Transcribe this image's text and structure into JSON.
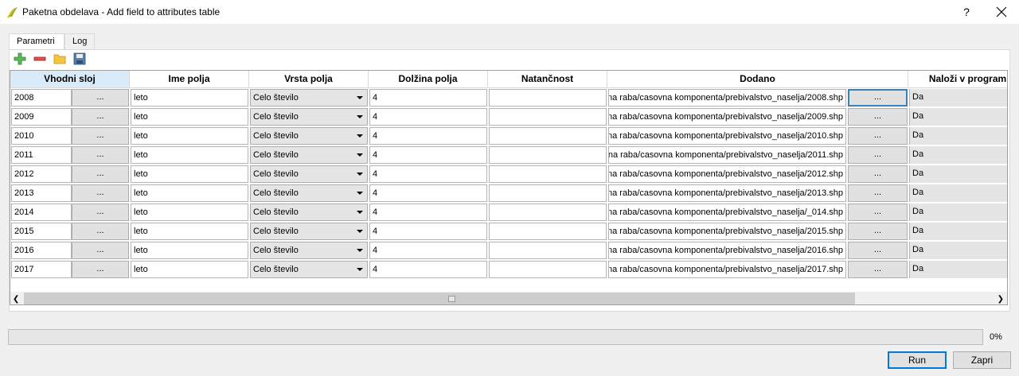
{
  "window": {
    "title": "Paketna obdelava - Add field to attributes table",
    "help_label": "?",
    "app_icon": "qgis-icon",
    "close_icon": "close-icon"
  },
  "tabs": [
    {
      "label": "Parametri",
      "active": true
    },
    {
      "label": "Log",
      "active": false
    }
  ],
  "toolbar": {
    "add_row": "add-row-icon",
    "remove_row": "remove-row-icon",
    "open": "folder-open-icon",
    "save": "save-icon"
  },
  "table": {
    "columns": [
      "Vhodni sloj",
      "Ime polja",
      "Vrsta polja",
      "Dolžina polja",
      "Natančnost",
      "Dodano",
      "Naloži v program"
    ],
    "browse_label": "...",
    "rows": [
      {
        "layer": "2008",
        "field_name": "leto",
        "field_type": "Celo število",
        "length": "4",
        "precision": "",
        "output": "na raba/casovna komponenta/prebivalstvo_naselja/2008.shp",
        "load": "Da"
      },
      {
        "layer": "2009",
        "field_name": "leto",
        "field_type": "Celo število",
        "length": "4",
        "precision": "",
        "output": "na raba/casovna komponenta/prebivalstvo_naselja/2009.shp",
        "load": "Da"
      },
      {
        "layer": "2010",
        "field_name": "leto",
        "field_type": "Celo število",
        "length": "4",
        "precision": "",
        "output": "na raba/casovna komponenta/prebivalstvo_naselja/2010.shp",
        "load": "Da"
      },
      {
        "layer": "2011",
        "field_name": "leto",
        "field_type": "Celo število",
        "length": "4",
        "precision": "",
        "output": "na raba/casovna komponenta/prebivalstvo_naselja/2011.shp",
        "load": "Da"
      },
      {
        "layer": "2012",
        "field_name": "leto",
        "field_type": "Celo število",
        "length": "4",
        "precision": "",
        "output": "na raba/casovna komponenta/prebivalstvo_naselja/2012.shp",
        "load": "Da"
      },
      {
        "layer": "2013",
        "field_name": "leto",
        "field_type": "Celo število",
        "length": "4",
        "precision": "",
        "output": "na raba/casovna komponenta/prebivalstvo_naselja/2013.shp",
        "load": "Da"
      },
      {
        "layer": "2014",
        "field_name": "leto",
        "field_type": "Celo število",
        "length": "4",
        "precision": "",
        "output": "na raba/casovna komponenta/prebivalstvo_naselja/_014.shp",
        "load": "Da"
      },
      {
        "layer": "2015",
        "field_name": "leto",
        "field_type": "Celo število",
        "length": "4",
        "precision": "",
        "output": "na raba/casovna komponenta/prebivalstvo_naselja/2015.shp",
        "load": "Da"
      },
      {
        "layer": "2016",
        "field_name": "leto",
        "field_type": "Celo število",
        "length": "4",
        "precision": "",
        "output": "na raba/casovna komponenta/prebivalstvo_naselja/2016.shp",
        "load": "Da"
      },
      {
        "layer": "2017",
        "field_name": "leto",
        "field_type": "Celo število",
        "length": "4",
        "precision": "",
        "output": "na raba/casovna komponenta/prebivalstvo_naselja/2017.shp",
        "load": "Da"
      }
    ]
  },
  "progress": {
    "value": 0,
    "label": "0%"
  },
  "buttons": {
    "run": "Run",
    "close": "Zapri"
  },
  "colors": {
    "accent": "#0078d7",
    "selected_header": "#d9ebf9"
  }
}
